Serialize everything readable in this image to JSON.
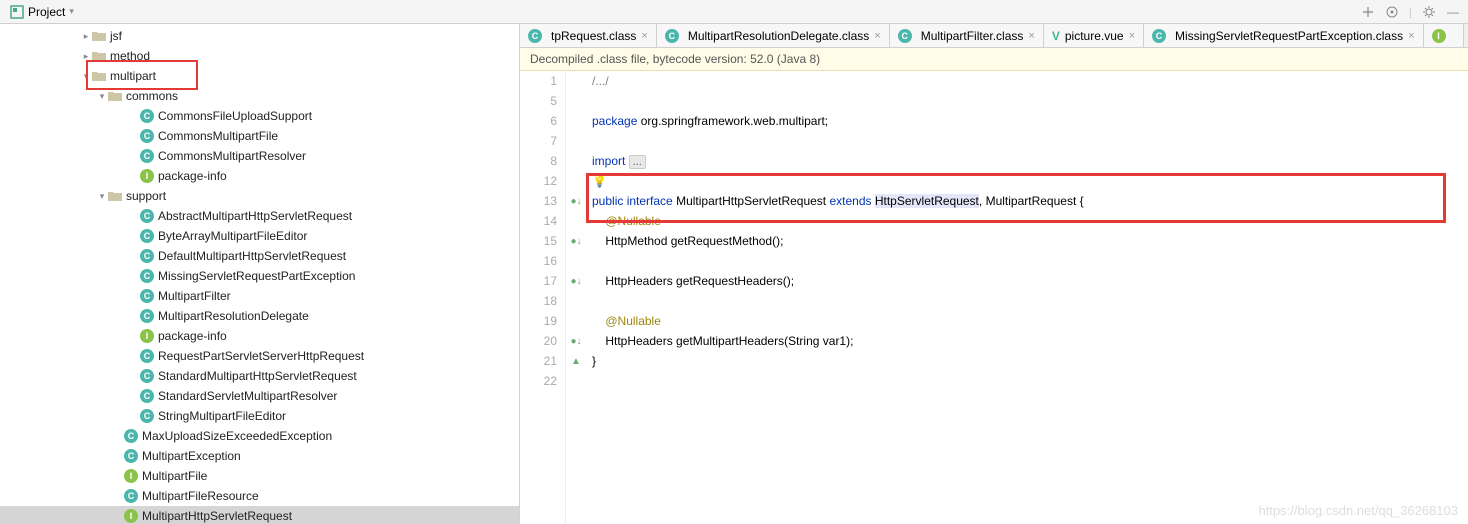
{
  "toolbar": {
    "project_label": "Project",
    "dropdown": "▾"
  },
  "tabs": [
    {
      "icon": "c",
      "label": "tpRequest.class",
      "partial": true
    },
    {
      "icon": "c",
      "label": "MultipartResolutionDelegate.class"
    },
    {
      "icon": "c",
      "label": "MultipartFilter.class"
    },
    {
      "icon": "v",
      "label": "picture.vue"
    },
    {
      "icon": "c",
      "label": "MissingServletRequestPartException.class"
    },
    {
      "icon": "i",
      "label": ""
    }
  ],
  "banner": "Decompiled .class file, bytecode version: 52.0 (Java 8)",
  "tree": [
    {
      "indent": 5,
      "tw": ">",
      "type": "folder",
      "label": "jsf"
    },
    {
      "indent": 5,
      "tw": ">",
      "type": "folder",
      "label": "method"
    },
    {
      "indent": 5,
      "tw": "v",
      "type": "folder",
      "label": "multipart",
      "hl": true
    },
    {
      "indent": 6,
      "tw": "v",
      "type": "folder",
      "label": "commons"
    },
    {
      "indent": 8,
      "tw": "",
      "type": "c",
      "label": "CommonsFileUploadSupport"
    },
    {
      "indent": 8,
      "tw": "",
      "type": "c",
      "label": "CommonsMultipartFile"
    },
    {
      "indent": 8,
      "tw": "",
      "type": "c",
      "label": "CommonsMultipartResolver"
    },
    {
      "indent": 8,
      "tw": "",
      "type": "i",
      "label": "package-info"
    },
    {
      "indent": 6,
      "tw": "v",
      "type": "folder",
      "label": "support"
    },
    {
      "indent": 8,
      "tw": "",
      "type": "c",
      "label": "AbstractMultipartHttpServletRequest"
    },
    {
      "indent": 8,
      "tw": "",
      "type": "c",
      "label": "ByteArrayMultipartFileEditor"
    },
    {
      "indent": 8,
      "tw": "",
      "type": "c",
      "label": "DefaultMultipartHttpServletRequest"
    },
    {
      "indent": 8,
      "tw": "",
      "type": "c",
      "label": "MissingServletRequestPartException"
    },
    {
      "indent": 8,
      "tw": "",
      "type": "c",
      "label": "MultipartFilter"
    },
    {
      "indent": 8,
      "tw": "",
      "type": "c",
      "label": "MultipartResolutionDelegate"
    },
    {
      "indent": 8,
      "tw": "",
      "type": "i",
      "label": "package-info"
    },
    {
      "indent": 8,
      "tw": "",
      "type": "c",
      "label": "RequestPartServletServerHttpRequest"
    },
    {
      "indent": 8,
      "tw": "",
      "type": "c",
      "label": "StandardMultipartHttpServletRequest"
    },
    {
      "indent": 8,
      "tw": "",
      "type": "c",
      "label": "StandardServletMultipartResolver"
    },
    {
      "indent": 8,
      "tw": "",
      "type": "c",
      "label": "StringMultipartFileEditor"
    },
    {
      "indent": 7,
      "tw": "",
      "type": "c",
      "label": "MaxUploadSizeExceededException"
    },
    {
      "indent": 7,
      "tw": "",
      "type": "c",
      "label": "MultipartException"
    },
    {
      "indent": 7,
      "tw": "",
      "type": "i",
      "label": "MultipartFile"
    },
    {
      "indent": 7,
      "tw": "",
      "type": "c",
      "label": "MultipartFileResource"
    },
    {
      "indent": 7,
      "tw": "",
      "type": "i",
      "label": "MultipartHttpServletRequest",
      "sel": true
    }
  ],
  "code": {
    "lines": [
      {
        "n": 1,
        "t": "/.../",
        "cls": "cmt",
        "fold": true
      },
      {
        "n": 5,
        "t": ""
      },
      {
        "n": 6,
        "t": "package org.springframework.web.multipart;",
        "pkg": true
      },
      {
        "n": 7,
        "t": ""
      },
      {
        "n": 8,
        "t": "import ...",
        "imp": true
      },
      {
        "n": 12,
        "t": "",
        "bulb": true
      },
      {
        "n": 13,
        "t": "public interface MultipartHttpServletRequest extends HttpServletRequest, MultipartRequest {",
        "mark": "o",
        "decl": true
      },
      {
        "n": 14,
        "t": "    @Nullable",
        "ann": true
      },
      {
        "n": 15,
        "t": "    HttpMethod getRequestMethod();",
        "mark": "o"
      },
      {
        "n": 16,
        "t": ""
      },
      {
        "n": 17,
        "t": "    HttpHeaders getRequestHeaders();",
        "mark": "o"
      },
      {
        "n": 18,
        "t": ""
      },
      {
        "n": 19,
        "t": "    @Nullable",
        "ann": true
      },
      {
        "n": 20,
        "t": "    HttpHeaders getMultipartHeaders(String var1);",
        "mark": "o"
      },
      {
        "n": 21,
        "t": "}",
        "mark": "c"
      },
      {
        "n": 22,
        "t": ""
      }
    ]
  },
  "watermark": "https://blog.csdn.net/qq_36268103"
}
